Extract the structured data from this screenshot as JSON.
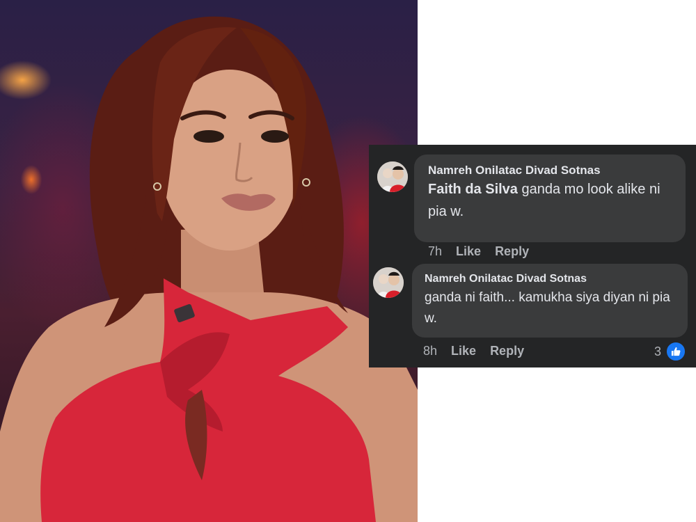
{
  "comments": [
    {
      "author": "Namreh Onilatac Divad Sotnas",
      "mention": "Faith da Silva",
      "text": " ganda mo look alike ni pia w.",
      "time": "7h",
      "like_label": "Like",
      "reply_label": "Reply"
    },
    {
      "author": "Namreh Onilatac Divad Sotnas",
      "text": "ganda ni faith... kamukha siya diyan ni pia w.",
      "time": "8h",
      "like_label": "Like",
      "reply_label": "Reply",
      "reaction_count": "3",
      "reaction_icon": "thumbs-up-icon",
      "reaction_color": "#1877f2"
    }
  ],
  "colors": {
    "panel_bg": "#242526",
    "bubble_bg": "#3a3b3c",
    "text": "#e4e6eb",
    "meta": "#b0b3b8"
  }
}
